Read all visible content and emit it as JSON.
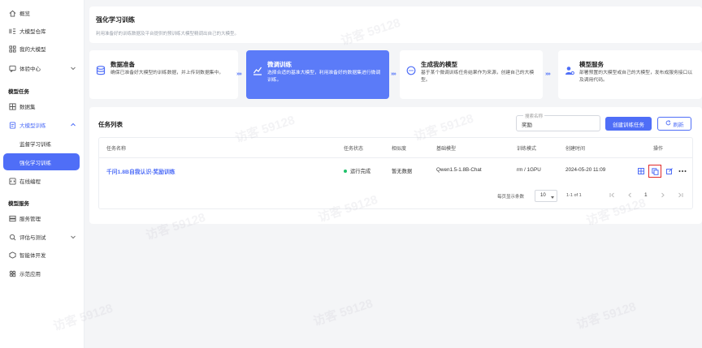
{
  "sidebar": {
    "items": [
      {
        "label": "概览",
        "icon": "home-icon"
      },
      {
        "label": "大模型仓库",
        "icon": "repository-icon"
      },
      {
        "label": "我的大模型",
        "icon": "model-icon"
      },
      {
        "label": "体验中心",
        "icon": "chat-icon"
      }
    ],
    "section_task": "模型任务",
    "task_items": [
      {
        "label": "数据集",
        "icon": "dataset-icon"
      },
      {
        "label": "大模型训练",
        "icon": "training-icon"
      },
      {
        "label": "监督学习训练"
      },
      {
        "label": "强化学习训练"
      },
      {
        "label": "在线编程",
        "icon": "code-icon"
      }
    ],
    "section_service": "模型服务",
    "service_items": [
      {
        "label": "服务管理",
        "icon": "service-icon"
      },
      {
        "label": "评估与测试",
        "icon": "evaluation-icon"
      },
      {
        "label": "智能体开发",
        "icon": "agent-icon"
      },
      {
        "label": "示范应用",
        "icon": "apps-icon"
      }
    ]
  },
  "header": {
    "title": "强化学习训练",
    "subtitle": "利用准备好的训练数据及平台提供的预训练大模型精调出自己的大模型。"
  },
  "steps": [
    {
      "title": "数据准备",
      "desc": "确保已准备好大模型的训练数据，并上传到数据集中。"
    },
    {
      "title": "微调训练",
      "desc": "选择合适的基准大模型，利用准备好的数据集进行微调训练。"
    },
    {
      "title": "生成我的模型",
      "desc": "基于某个微调训练任务结果作为来源，创建自己的大模型。"
    },
    {
      "title": "模型服务",
      "desc": "部署预置的大模型或自己的大模型，发布成服务接口以及调用代码。"
    }
  ],
  "step_arrow": "»»",
  "task_list": {
    "title": "任务列表",
    "search": {
      "label": "搜索名称",
      "value": "奖励"
    },
    "create_button": "创建训练任务",
    "refresh_button": "刷新",
    "columns": [
      "任务名称",
      "任务状态",
      "相似度",
      "基础模型",
      "训练模式",
      "创建时间",
      "操作"
    ],
    "rows": [
      {
        "name": "千问1.8B自我认识-奖励训练",
        "status": "运行完成",
        "similarity": "暂无数据",
        "base_model": "Qwen1.5-1.8B-Chat",
        "mode": "rm / 1GPU",
        "created": "2024-05-20 11:09"
      }
    ],
    "pagination": {
      "per_page_label": "每页显示条数",
      "per_page": "10",
      "range": "1-1 of 1",
      "current_page": "1"
    }
  },
  "watermark": "访客 59128",
  "colors": {
    "accent": "#4f6ef7",
    "success": "#20c26b",
    "highlight": "#e02a2a"
  }
}
